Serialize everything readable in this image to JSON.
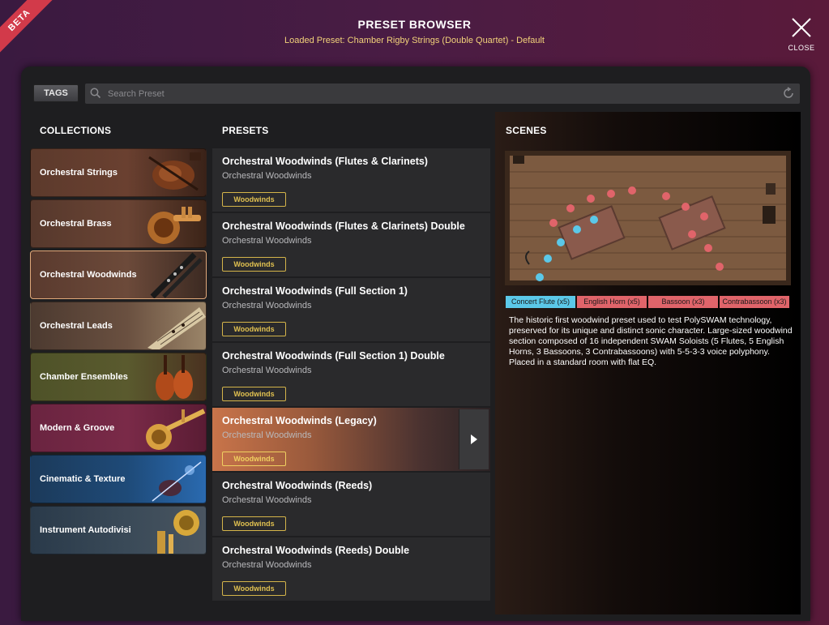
{
  "header": {
    "title": "PRESET BROWSER",
    "subtitle": "Loaded Preset: Chamber Rigby Strings (Double Quartet) - Default",
    "beta": "BETA",
    "close_label": "CLOSE"
  },
  "toolbar": {
    "tags_label": "TAGS",
    "search_placeholder": "Search Preset"
  },
  "collections": {
    "heading": "COLLECTIONS",
    "items": [
      {
        "label": "Orchestral Strings",
        "icon": "violin-icon"
      },
      {
        "label": "Orchestral Brass",
        "icon": "trumpet-icon"
      },
      {
        "label": "Orchestral Woodwinds",
        "icon": "clarinet-icon",
        "selected": true
      },
      {
        "label": "Orchestral Leads",
        "icon": "sheet-music-icon"
      },
      {
        "label": "Chamber Ensembles",
        "icon": "cello-icon"
      },
      {
        "label": "Modern & Groove",
        "icon": "trumpet-icon"
      },
      {
        "label": "Cinematic & Texture",
        "icon": "violin-icon"
      },
      {
        "label": "Instrument Autodivisi",
        "icon": "tuba-icon"
      }
    ]
  },
  "presets": {
    "heading": "PRESETS",
    "items": [
      {
        "name": "Orchestral Woodwinds (Flutes & Clarinets)",
        "category": "Orchestral Woodwinds",
        "tag": "Woodwinds"
      },
      {
        "name": "Orchestral Woodwinds (Flutes & Clarinets) Double",
        "category": "Orchestral Woodwinds",
        "tag": "Woodwinds"
      },
      {
        "name": "Orchestral Woodwinds (Full Section 1)",
        "category": "Orchestral Woodwinds",
        "tag": "Woodwinds"
      },
      {
        "name": "Orchestral Woodwinds (Full Section 1) Double",
        "category": "Orchestral Woodwinds",
        "tag": "Woodwinds"
      },
      {
        "name": "Orchestral Woodwinds (Legacy)",
        "category": "Orchestral Woodwinds",
        "tag": "Woodwinds",
        "active": true
      },
      {
        "name": "Orchestral Woodwinds (Reeds)",
        "category": "Orchestral Woodwinds",
        "tag": "Woodwinds"
      },
      {
        "name": "Orchestral Woodwinds (Reeds) Double",
        "category": "Orchestral Woodwinds",
        "tag": "Woodwinds"
      }
    ]
  },
  "scenes": {
    "heading": "SCENES",
    "legend": [
      {
        "label": "Concert Flute (x5)",
        "color": "#5bc8e8"
      },
      {
        "label": "English Horn (x5)",
        "color": "#e0646a"
      },
      {
        "label": "Bassoon (x3)",
        "color": "#e0646a"
      },
      {
        "label": "Contrabassoon (x3)",
        "color": "#e0646a"
      }
    ],
    "description": "The historic first woodwind preset used to test PolySWAM technology, preserved for its unique and distinct sonic character. Large-sized woodwind section composed of 16 independent SWAM Soloists (5 Flutes, 5 English Horns, 3 Bassoons, 3 Contrabassoons) with 5-5-3-3 voice polyphony. Placed in a standard room with flat EQ."
  },
  "colors": {
    "accent_gold": "#d4b44a",
    "flute_blue": "#5bc8e8",
    "reed_red": "#e0646a"
  }
}
